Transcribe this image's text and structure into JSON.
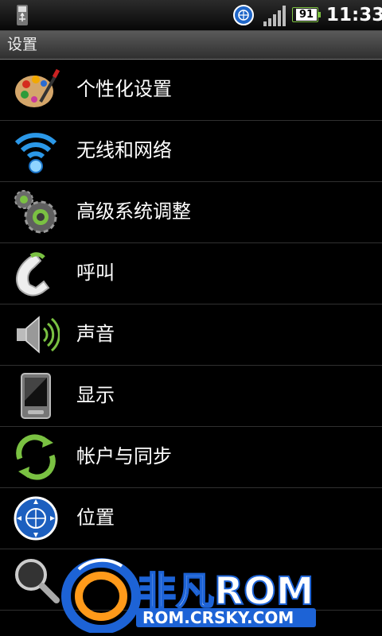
{
  "status_bar": {
    "time": "11:33",
    "battery_level": "91",
    "icons": [
      "sd-card-icon",
      "sync-icon",
      "signal-icon",
      "battery-icon"
    ],
    "battery_color": "#7dc242"
  },
  "header": {
    "title": "设置"
  },
  "settings_list": {
    "items": [
      {
        "label": "个性化设置",
        "icon": "palette-icon"
      },
      {
        "label": "无线和网络",
        "icon": "wifi-icon"
      },
      {
        "label": "高级系统调整",
        "icon": "gears-icon"
      },
      {
        "label": "呼叫",
        "icon": "phone-icon"
      },
      {
        "label": "声音",
        "icon": "speaker-icon"
      },
      {
        "label": "显示",
        "icon": "display-icon"
      },
      {
        "label": "帐户与同步",
        "icon": "sync-arrows-icon"
      },
      {
        "label": "位置",
        "icon": "location-icon"
      },
      {
        "label": "",
        "icon": "search-icon"
      }
    ]
  },
  "watermark": {
    "brand": "非凡ROM",
    "url": "ROM.CRSKY.COM"
  }
}
